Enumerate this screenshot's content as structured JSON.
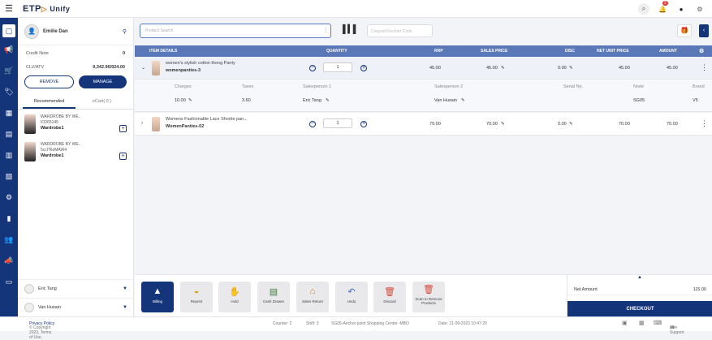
{
  "header": {
    "logo": "ETP",
    "logo_sub": "Unify",
    "notification_count": "2"
  },
  "customer": {
    "name": "Emilie Dan",
    "credit_note_label": "Credit Note",
    "credit_note_value": "0",
    "clv_label": "CLV/ATV",
    "clv_value": "9,342.96/924.00",
    "remove_label": "REMOVE",
    "manage_label": "MANAGE"
  },
  "tabs": {
    "recommended": "Recommended",
    "ecart": "eCart( 0 )"
  },
  "recommended": [
    {
      "line1": "WARDROBE BY WE..",
      "line2": "IO265145",
      "brand": "Wardrobe1"
    },
    {
      "line1": "WARDROBE BY WE..",
      "line2": "5ccl?6oMAW4",
      "brand": "Wardrobe1"
    }
  ],
  "salespersons": [
    "Eric Tang",
    "Van Husain"
  ],
  "search": {
    "placeholder": "Product Search",
    "coupon_placeholder": "Coupon/Voucher Code"
  },
  "table": {
    "headers": {
      "item": "ITEM DETAILS",
      "qty": "QUANTITY",
      "rrp": "RRP",
      "sales": "SALES PRICE",
      "disc": "DISC",
      "nup": "NET UNIT PRICE",
      "amount": "AMOUNT"
    },
    "rows": [
      {
        "name": "women's stylish cotton thong Panty",
        "code": "womenpanties-3",
        "qty": "1",
        "rrp": "45.00",
        "sales": "45.00",
        "disc": "0.00",
        "nup": "45.00",
        "amount": "45.00"
      },
      {
        "name": "Womens Fashionable Lace Shortie pan...",
        "code": "WomenPanties-02",
        "qty": "1",
        "rrp": "79.00",
        "sales": "70.00",
        "disc": "0.00",
        "nup": "70.00",
        "amount": "70.00"
      }
    ],
    "detail": {
      "labels": {
        "charges": "Charges",
        "taxes": "Taxes",
        "sp1": "Salesperson 1",
        "sp2": "Salesperson 2",
        "serial": "Serial No.",
        "node": "Node",
        "brand": "Brand"
      },
      "values": {
        "charges": "10.00",
        "taxes": "3.60",
        "sp1": "Eric Tang",
        "sp2": "Van Husain",
        "serial": "",
        "node": "SG05",
        "brand": "V5"
      }
    }
  },
  "actions": [
    {
      "label": "Billing",
      "icon": "▲"
    },
    {
      "label": "Reprint",
      "icon": "◒"
    },
    {
      "label": "Hold",
      "icon": "✋"
    },
    {
      "label": "Cash Drawer",
      "icon": "▤"
    },
    {
      "label": "Sales Return",
      "icon": "⌂"
    },
    {
      "label": "Undo",
      "icon": "↶"
    },
    {
      "label": "Discard",
      "icon": "🗑"
    },
    {
      "label": "Scan to Remove Products",
      "icon": "🗑"
    }
  ],
  "totals": {
    "net_label": "Net Amount",
    "net_value": "115.00",
    "checkout": "CHECKOUT"
  },
  "footer": {
    "copyright": "© Copyright 2023, Terms of Use,",
    "privacy": "Privacy Policy",
    "counter": "Counter: 2",
    "shift": "Shift: 3",
    "store": "SG05-Anchor point Shopping Centre -MBO",
    "date": "Date: 21-09-2023 10:47:20",
    "support": "Live Support"
  }
}
